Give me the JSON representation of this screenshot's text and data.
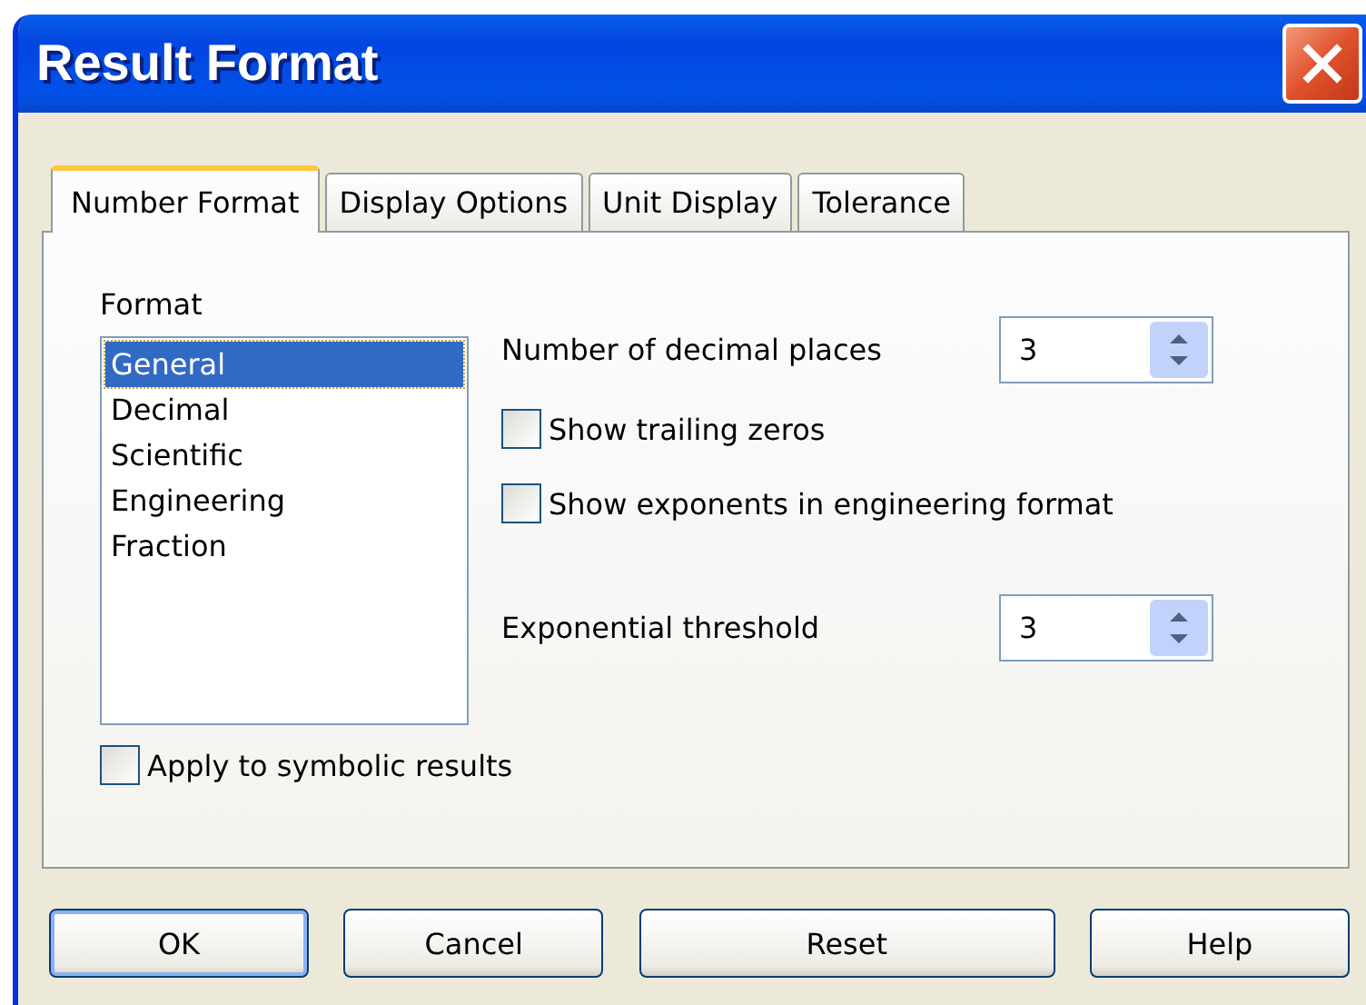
{
  "window": {
    "title": "Result Format"
  },
  "tabs": [
    {
      "label": "Number Format",
      "selected": true
    },
    {
      "label": "Display Options",
      "selected": false
    },
    {
      "label": "Unit Display",
      "selected": false
    },
    {
      "label": "Tolerance",
      "selected": false
    }
  ],
  "format": {
    "label": "Format",
    "items": [
      {
        "label": "General",
        "selected": true
      },
      {
        "label": "Decimal",
        "selected": false
      },
      {
        "label": "Scientific",
        "selected": false
      },
      {
        "label": "Engineering",
        "selected": false
      },
      {
        "label": "Fraction",
        "selected": false
      }
    ]
  },
  "decimal_places": {
    "label": "Number of decimal places",
    "value": "3"
  },
  "options": [
    {
      "label": "Show trailing zeros",
      "checked": false
    },
    {
      "label": "Show exponents in engineering format",
      "checked": false
    }
  ],
  "exponential_threshold": {
    "label": "Exponential threshold",
    "value": "3"
  },
  "apply_symbolic": {
    "label": "Apply to symbolic results",
    "checked": false
  },
  "buttons": [
    {
      "label": "OK",
      "default": true
    },
    {
      "label": "Cancel",
      "default": false
    },
    {
      "label": "Reset",
      "default": false
    },
    {
      "label": "Help",
      "default": false
    }
  ]
}
